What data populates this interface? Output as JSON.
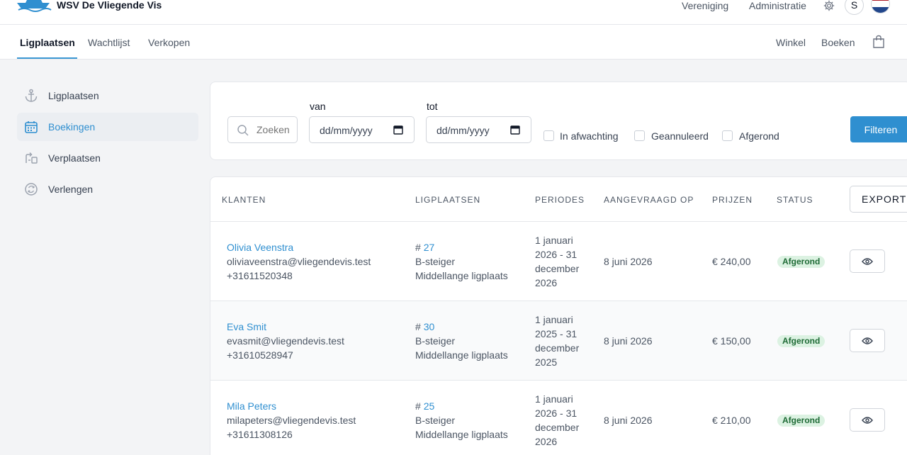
{
  "header": {
    "brand": "WSV De Vliegende Vis",
    "nav": [
      "Vereniging",
      "Administratie"
    ],
    "avatar_initial": "S"
  },
  "subnav": {
    "tabs": [
      "Ligplaatsen",
      "Wachtlijst",
      "Verkopen"
    ],
    "right": [
      "Winkel",
      "Boeken"
    ]
  },
  "sidebar": {
    "items": [
      {
        "label": "Ligplaatsen",
        "icon": "anchor-icon"
      },
      {
        "label": "Boekingen",
        "icon": "calendar-icon"
      },
      {
        "label": "Verplaatsen",
        "icon": "move-icon"
      },
      {
        "label": "Verlengen",
        "icon": "renew-icon"
      }
    ]
  },
  "filters": {
    "search_placeholder": "Zoeken",
    "from_label": "van",
    "to_label": "tot",
    "date_placeholder": "dd/mm/yyyy",
    "checkboxes": [
      "In afwachting",
      "Geannuleerd",
      "Afgerond"
    ],
    "submit_label": "Filteren"
  },
  "table": {
    "columns": [
      "Klanten",
      "Ligplaatsen",
      "Periodes",
      "Aangevraagd op",
      "Prijzen",
      "Status"
    ],
    "export_label": "EXPORT",
    "rows": [
      {
        "name": "Olivia Veenstra",
        "email": "oliviaveenstra@vliegendevis.test",
        "phone": "+31611520348",
        "berth_number": "27",
        "pier": "B-steiger",
        "berth_type": "Middellange ligplaats",
        "period": [
          "1 januari",
          "2026 - 31",
          "december",
          "2026"
        ],
        "requested": "8 juni 2026",
        "price": "€ 240,00",
        "status": "Afgerond"
      },
      {
        "name": "Eva Smit",
        "email": "evasmit@vliegendevis.test",
        "phone": "+31610528947",
        "berth_number": "30",
        "pier": "B-steiger",
        "berth_type": "Middellange ligplaats",
        "period": [
          "1 januari",
          "2025 - 31",
          "december",
          "2025"
        ],
        "requested": "8 juni 2026",
        "price": "€ 150,00",
        "status": "Afgerond"
      },
      {
        "name": "Mila Peters",
        "email": "milapeters@vliegendevis.test",
        "phone": "+31611308126",
        "berth_number": "25",
        "pier": "B-steiger",
        "berth_type": "Middellange ligplaats",
        "period": [
          "1 januari",
          "2026 - 31",
          "december",
          "2026"
        ],
        "requested": "8 juni 2026",
        "price": "€ 210,00",
        "status": "Afgerond"
      }
    ]
  },
  "colors": {
    "accent": "#2f8fd0",
    "badge_bg": "#dcf2e2",
    "badge_text": "#1f6b36"
  }
}
